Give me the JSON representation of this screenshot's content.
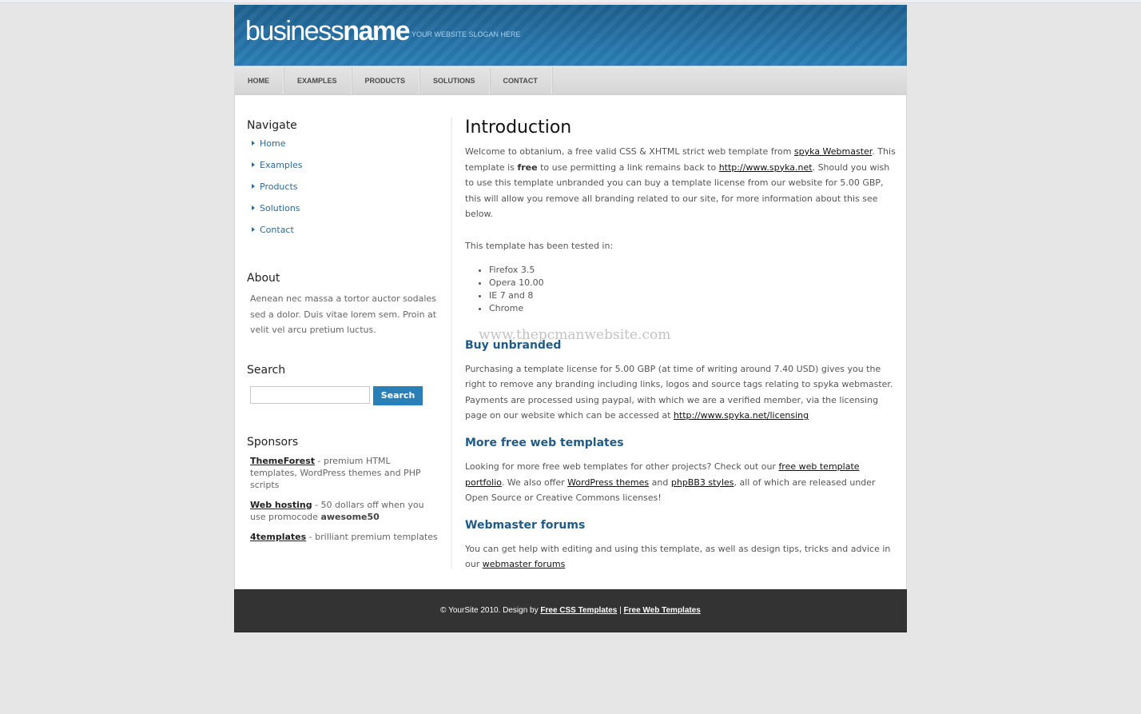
{
  "header": {
    "logo_light": "business",
    "logo_bold": "name",
    "slogan": "YOUR WEBSITE SLOGAN HERE"
  },
  "nav": {
    "items": [
      {
        "label": "HOME"
      },
      {
        "label": "EXAMPLES"
      },
      {
        "label": "PRODUCTS"
      },
      {
        "label": "SOLUTIONS"
      },
      {
        "label": "CONTACT"
      }
    ]
  },
  "sidebar": {
    "navigate_title": "Navigate",
    "navigate_items": [
      {
        "label": "Home"
      },
      {
        "label": "Examples"
      },
      {
        "label": "Products"
      },
      {
        "label": "Solutions"
      },
      {
        "label": "Contact"
      }
    ],
    "about_title": "About",
    "about_text": "Aenean nec massa a tortor auctor sodales sed a dolor. Duis vitae lorem sem. Proin at velit vel arcu pretium luctus.",
    "search_title": "Search",
    "search_value": "",
    "search_button": "Search",
    "sponsors_title": "Sponsors",
    "sponsors": [
      {
        "link": "ThemeForest",
        "text": " - premium HTML templates, WordPress themes and PHP scripts",
        "bold": ""
      },
      {
        "link": "Web hosting",
        "text": " - 50 dollars off when you use promocode ",
        "bold": "awesome50"
      },
      {
        "link": "4templates",
        "text": " - brilliant premium templates",
        "bold": ""
      }
    ]
  },
  "main": {
    "intro_title": "Introduction",
    "intro_p1_a": "Welcome to obtanium, a free valid CSS & XHTML strict web template from ",
    "intro_link1": "spyka Webmaster",
    "intro_p1_b": ". This template is ",
    "intro_bold": "free",
    "intro_p1_c": " to use permitting a link remains back to ",
    "intro_link2": "http://www.spyka.net",
    "intro_p1_d": ". Should you wish to use this template unbranded you can buy a template license from our website for 5.00 GBP, this will allow you remove all branding related to our site, for more information about this see below.",
    "tested_text": "This template has been tested in:",
    "tested_items": [
      "Firefox 3.5",
      "Opera 10.00",
      "IE 7 and 8",
      "Chrome"
    ],
    "buy_title": "Buy unbranded",
    "buy_text": "Purchasing a template license for 5.00 GBP (at time of writing around 7.40 USD) gives you the right to remove any branding including links, logos and source tags relating to spyka webmaster. Payments are processed using paypal, with which we are a verified member, via the licensing page on our website which can be accessed at ",
    "buy_link": "http://www.spyka.net/licensing",
    "more_title": "More free web templates",
    "more_text_a": "Looking for more free web templates for other projects? Check out our ",
    "more_link1": "free web template portfolio",
    "more_text_b": ". We also offer ",
    "more_link2": "WordPress themes",
    "more_text_c": " and ",
    "more_link3": "phpBB3 styles",
    "more_text_d": ", all of which are released under Open Source or Creative Commons licenses!",
    "forums_title": "Webmaster forums",
    "forums_text": "You can get help with editing and using this template, as well as design tips, tricks and advice in our ",
    "forums_link": "webmaster forums",
    "watermark": "www.thepcmanwebsite.com"
  },
  "footer": {
    "text": "© YourSite 2010. Design by ",
    "link1": "Free CSS Templates",
    "sep": " | ",
    "link2": "Free Web Templates"
  }
}
